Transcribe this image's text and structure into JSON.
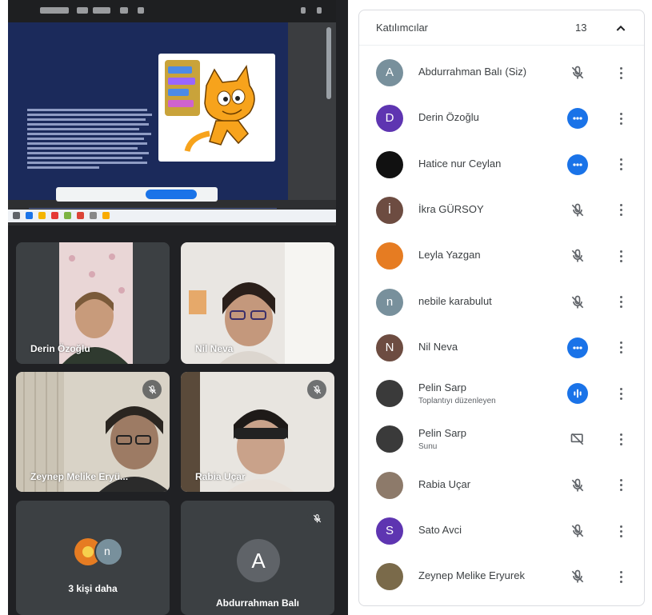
{
  "screen_share": {
    "slide_title": "",
    "share_bar_text": "",
    "share_bar_button": "",
    "share_bar_hide": "",
    "taskbar_time": ""
  },
  "tiles": [
    {
      "name": "Derin Özoğlu",
      "muted": false
    },
    {
      "name": "Nil Neva",
      "muted": false
    },
    {
      "name": "Zeynep Melike Eryü...",
      "muted": true
    },
    {
      "name": "Rabia Uçar",
      "muted": true
    }
  ],
  "more_tile": {
    "label": "3 kişi daha",
    "avatar_letter": "n"
  },
  "self_tile": {
    "name": "Abdurrahman Balı",
    "avatar_letter": "A",
    "muted": true
  },
  "panel": {
    "title": "Katılımcılar",
    "count": "13",
    "participants": [
      {
        "name": "Abdurrahman Balı (Siz)",
        "sub": "",
        "avatar_letter": "A",
        "avatar_color": "#78909c",
        "status": "muted"
      },
      {
        "name": "Derin Özoğlu",
        "sub": "",
        "avatar_letter": "D",
        "avatar_color": "#5e35b1",
        "status": "speaking-dots"
      },
      {
        "name": "Hatice nur Ceylan",
        "sub": "",
        "avatar_letter": "",
        "avatar_color": "#111111",
        "status": "speaking-dots"
      },
      {
        "name": "İkra GÜRSOY",
        "sub": "",
        "avatar_letter": "İ",
        "avatar_color": "#6d4c41",
        "status": "muted"
      },
      {
        "name": "Leyla Yazgan",
        "sub": "",
        "avatar_letter": "",
        "avatar_color": "#e67c22",
        "status": "muted"
      },
      {
        "name": "nebile karabulut",
        "sub": "",
        "avatar_letter": "n",
        "avatar_color": "#78909c",
        "status": "muted"
      },
      {
        "name": "Nil Neva",
        "sub": "",
        "avatar_letter": "N",
        "avatar_color": "#6d4c41",
        "status": "speaking-dots"
      },
      {
        "name": "Pelin Sarp",
        "sub": "Toplantıyı düzenleyen",
        "avatar_letter": "",
        "avatar_color": "#3a3a3a",
        "status": "speaking-bars"
      },
      {
        "name": "Pelin Sarp",
        "sub": "Sunu",
        "avatar_letter": "",
        "avatar_color": "#3a3a3a",
        "status": "presenting-muted"
      },
      {
        "name": "Rabia Uçar",
        "sub": "",
        "avatar_letter": "",
        "avatar_color": "#8d7a6a",
        "status": "muted"
      },
      {
        "name": "Sato Avci",
        "sub": "",
        "avatar_letter": "S",
        "avatar_color": "#5e35b1",
        "status": "muted"
      },
      {
        "name": "Zeynep Melike Eryurek",
        "sub": "",
        "avatar_letter": "",
        "avatar_color": "#7a6a4a",
        "status": "muted"
      }
    ]
  },
  "colors": {
    "accent": "#1a73e8",
    "meet_bg": "#202124",
    "tile_bg": "#3c4043"
  }
}
